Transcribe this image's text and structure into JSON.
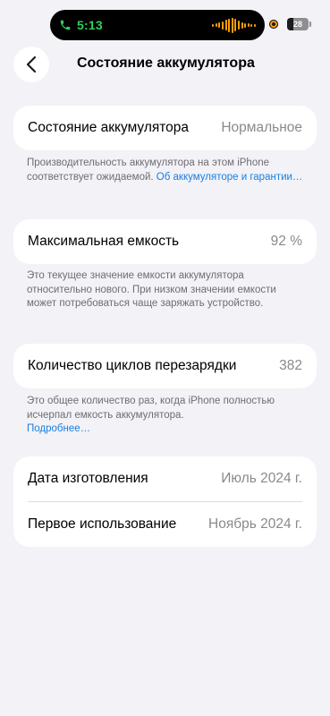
{
  "status_bar": {
    "call_time": "5:13",
    "battery_level": "28",
    "colors": {
      "call": "#30d158",
      "waveform": "#ff9f0a"
    }
  },
  "nav": {
    "title": "Состояние аккумулятора"
  },
  "health": {
    "label": "Состояние аккумулятора",
    "value": "Нормальное",
    "footnote_text": "Производительность аккумулятора на этом iPhone соответствует ожидаемой. ",
    "footnote_link": "Об аккумуляторе и гарантии…"
  },
  "capacity": {
    "label": "Максимальная емкость",
    "value": "92 %",
    "footnote_text": "Это текущее значение емкости аккумулятора относительно нового. При низком значении емкости может потребоваться чаще заряжать устройство."
  },
  "cycles": {
    "label": "Количество циклов перезарядки",
    "value": "382",
    "footnote_text": "Это общее количество раз, когда iPhone полностью исчерпал емкость аккумулятора.",
    "footnote_link": "Подробнее…"
  },
  "dates": {
    "manufacture_label": "Дата изготовления",
    "manufacture_value": "Июль 2024 г.",
    "first_use_label": "Первое использование",
    "first_use_value": "Ноябрь 2024 г."
  }
}
